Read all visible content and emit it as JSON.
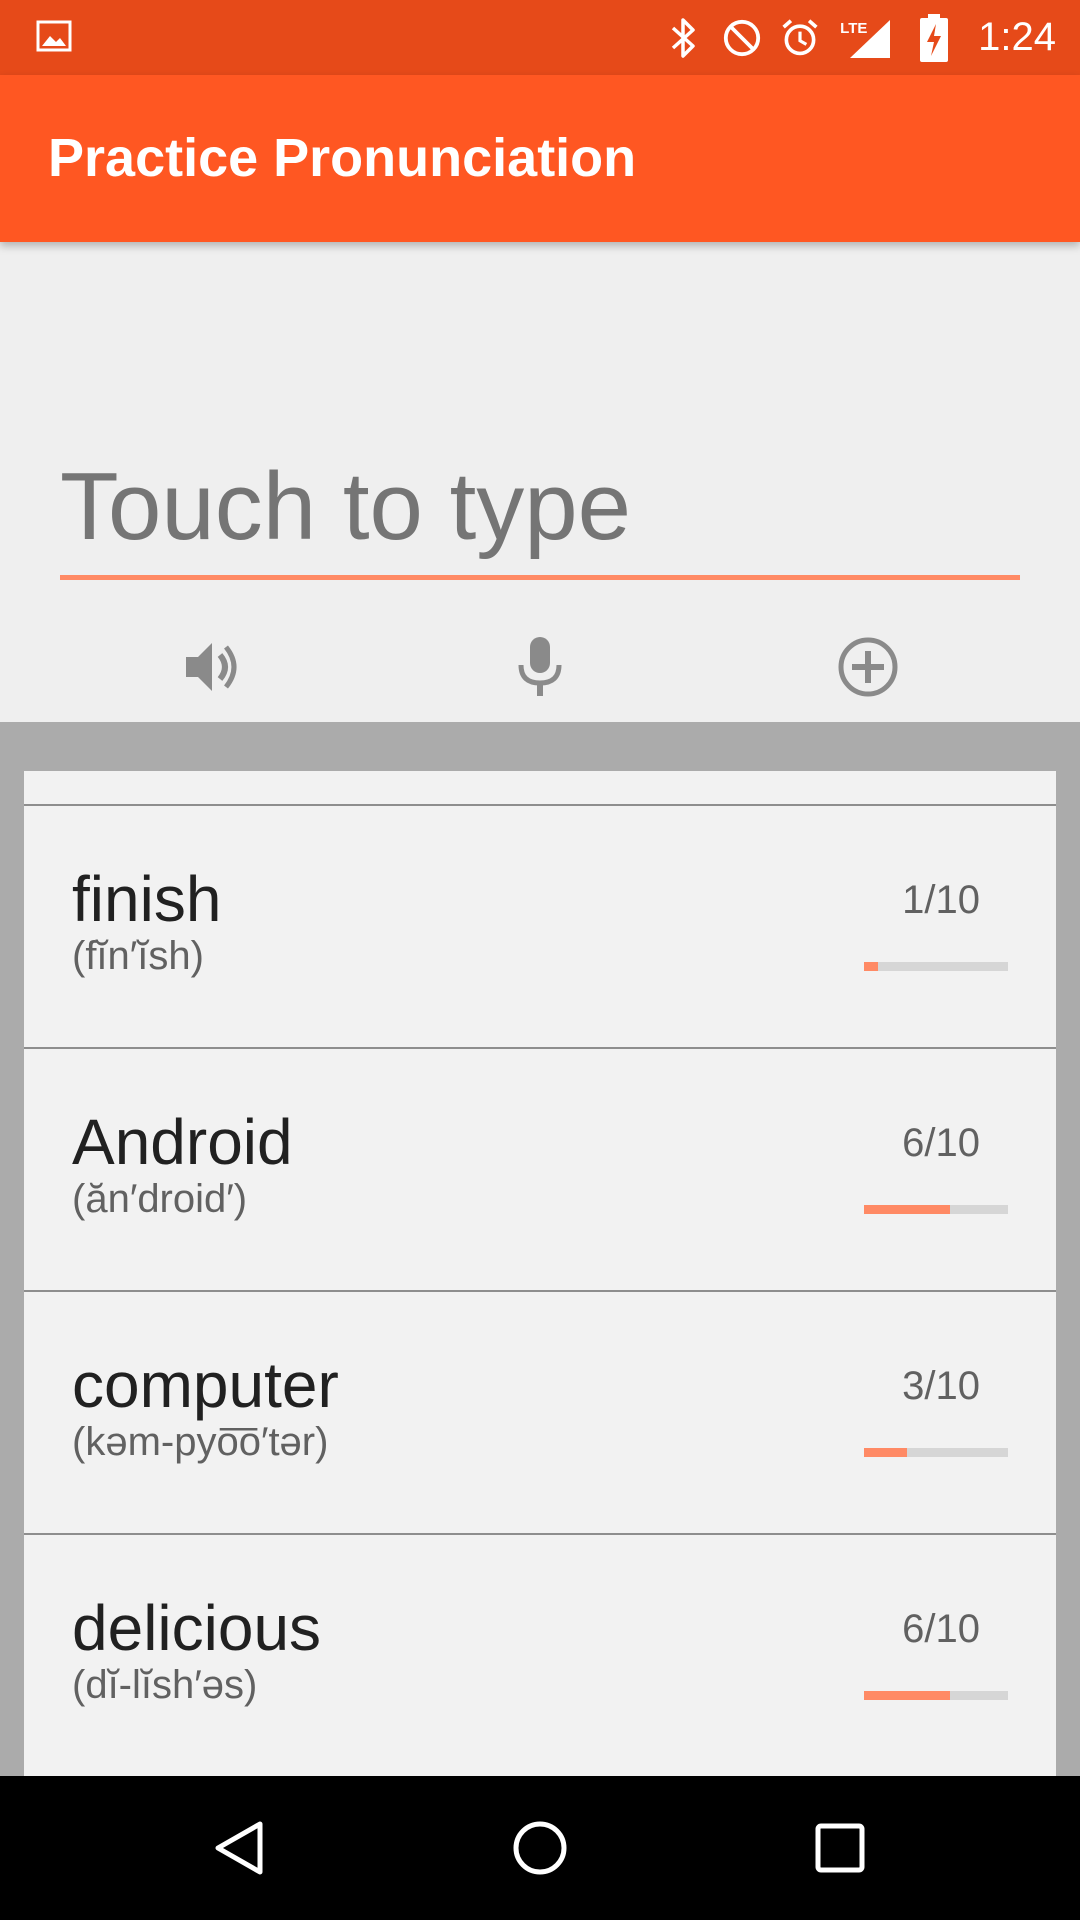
{
  "status_bar": {
    "time": "1:24",
    "network_label": "LTE",
    "icons": [
      "image-notification-icon",
      "bluetooth-icon",
      "do-not-disturb-icon",
      "alarm-icon",
      "signal-icon",
      "battery-charging-icon"
    ]
  },
  "app_bar": {
    "title": "Practice Pronunciation"
  },
  "input": {
    "placeholder": "Touch to type",
    "value": ""
  },
  "actions": {
    "speak_icon": "volume-icon",
    "mic_icon": "microphone-icon",
    "add_icon": "add-circle-icon"
  },
  "words": [
    {
      "word": "finish",
      "phonetic": "(fĭn′ĭsh)",
      "score_label": "1/10",
      "progress": 0.1
    },
    {
      "word": "Android",
      "phonetic": "(ăn′droid′)",
      "score_label": "6/10",
      "progress": 0.6
    },
    {
      "word": "computer",
      "phonetic": "(kəm-pyo͞o′tər)",
      "score_label": "3/10",
      "progress": 0.3
    },
    {
      "word": "delicious",
      "phonetic": "(dĭ-lĭsh′əs)",
      "score_label": "6/10",
      "progress": 0.6
    }
  ],
  "colors": {
    "status_bar": "#E64A19",
    "app_bar": "#FF5722",
    "accent": "#FF8A65",
    "list_background": "#ABABAB",
    "card_background": "#F2F2F2"
  },
  "nav_bar": {
    "back_icon": "back-icon",
    "home_icon": "home-icon",
    "recents_icon": "recents-icon"
  }
}
